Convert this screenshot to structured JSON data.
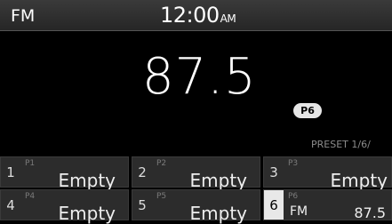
{
  "status": {
    "band": "FM",
    "time": "12:00",
    "ampm": "AM"
  },
  "main": {
    "frequency": "87.5",
    "preset_badge": "P6",
    "preset_info": "PRESET 1/6/"
  },
  "presets": [
    {
      "num": "1",
      "tag": "P1",
      "name": "Empty"
    },
    {
      "num": "2",
      "tag": "P2",
      "name": "Empty"
    },
    {
      "num": "3",
      "tag": "P3",
      "name": "Empty"
    },
    {
      "num": "4",
      "tag": "P4",
      "name": "Empty"
    },
    {
      "num": "5",
      "tag": "P5",
      "name": "Empty"
    },
    {
      "num": "6",
      "tag": "P6",
      "band": "FM",
      "freq": "87.5"
    }
  ]
}
